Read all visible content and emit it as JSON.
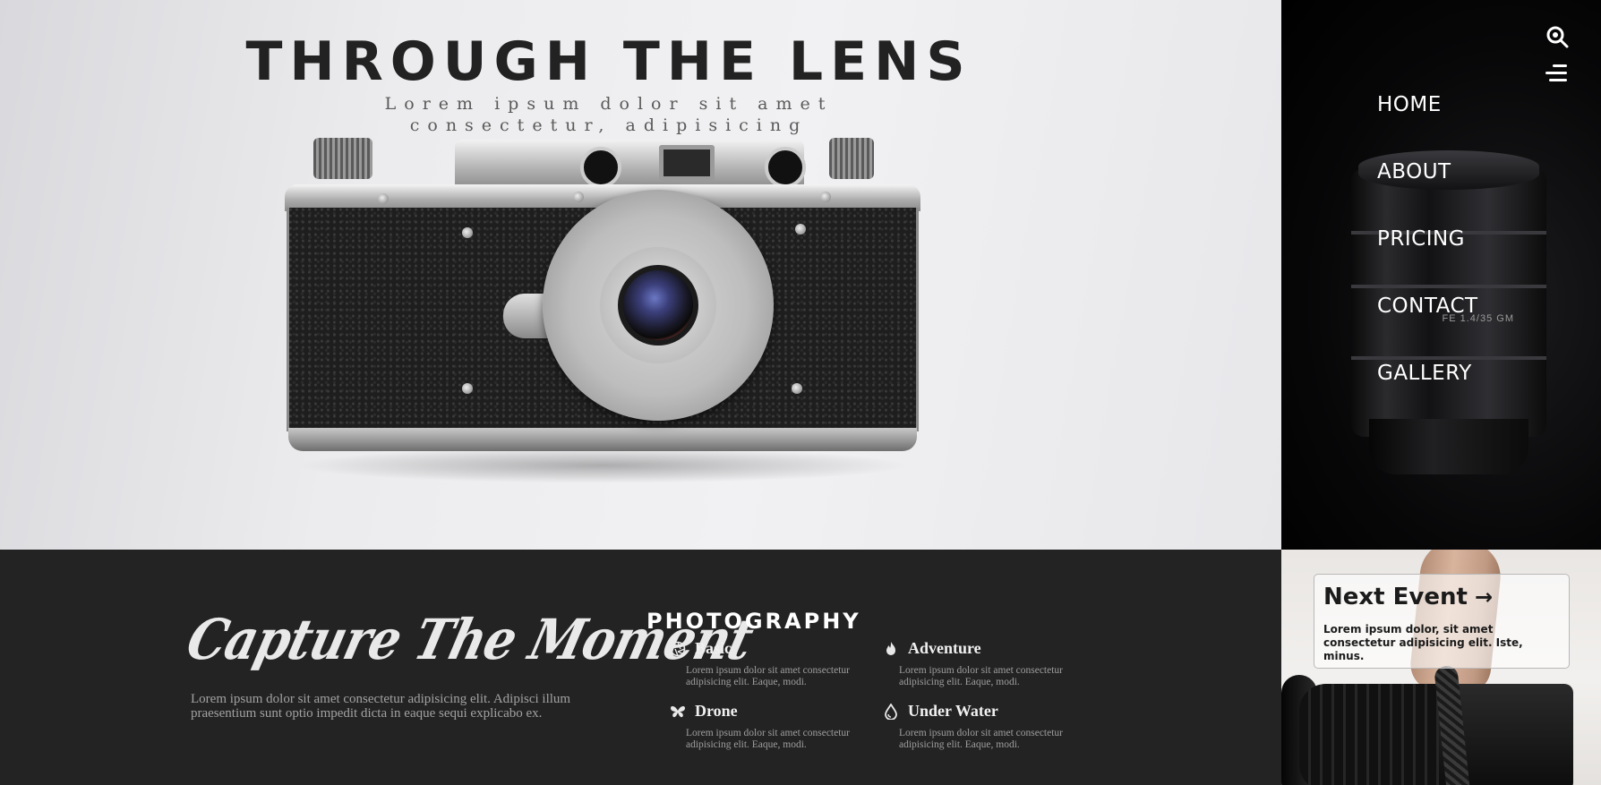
{
  "hero": {
    "title": "THROUGH THE LENS",
    "subtitle": "Lorem ipsum dolor sit amet consectetur, adipisicing"
  },
  "nav": {
    "icons": {
      "search": "search-icon",
      "menu": "menu-icon"
    },
    "items": [
      {
        "label": "HOME"
      },
      {
        "label": "ABOUT"
      },
      {
        "label": "PRICING"
      },
      {
        "label": "CONTACT"
      },
      {
        "label": "GALLERY"
      }
    ],
    "product_label": "FE 1.4/35 GM"
  },
  "capture": {
    "title": "Capture The Moment",
    "text": "Lorem ipsum dolor sit amet consectetur adipisicing elit. Adipisci illum praesentium sunt optio impedit dicta in eaque sequi explicabo ex."
  },
  "photography": {
    "title": "PHOTOGRAPHY",
    "services": [
      {
        "name": "Basic",
        "icon": "aperture-icon",
        "desc": "Lorem ipsum dolor sit amet consectetur adipisicing elit. Eaque, modi."
      },
      {
        "name": "Adventure",
        "icon": "fire-icon",
        "desc": "Lorem ipsum dolor sit amet consectetur adipisicing elit. Eaque, modi."
      },
      {
        "name": "Drone",
        "icon": "butterfly-icon",
        "desc": "Lorem ipsum dolor sit amet consectetur adipisicing elit. Eaque, modi."
      },
      {
        "name": "Under Water",
        "icon": "water-drop-icon",
        "desc": "Lorem ipsum dolor sit amet consectetur adipisicing elit. Eaque, modi."
      }
    ]
  },
  "event": {
    "title": "Next Event",
    "arrow": "→",
    "text": "Lorem ipsum dolor, sit amet consectetur adipisicing elit. Iste, minus."
  },
  "colors": {
    "hero_bg": "#ececee",
    "nav_bg": "#000000",
    "bottom_bg": "#232323",
    "text_light": "#ffffff",
    "text_muted": "#a2a2a2"
  }
}
